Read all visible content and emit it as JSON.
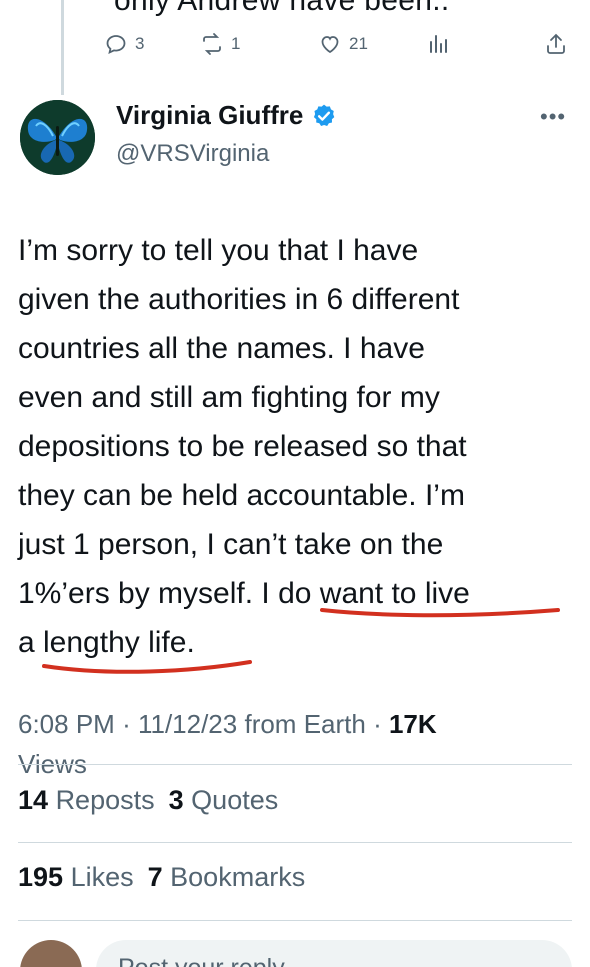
{
  "previous_tweet": {
    "text_fragment": "only Andrew have been..",
    "replies": "3",
    "reposts": "1",
    "likes": "21"
  },
  "tweet": {
    "display_name": "Virginia Giuffre",
    "handle": "@VRSVirginia",
    "text_lines": [
      "I’m sorry to tell you that I have",
      "given the authorities in 6 different",
      "countries all the names. I have",
      "even and still am fighting for my",
      "depositions to be released so that",
      "they can be held accountable. I’m",
      "just 1 person, I can’t take on the",
      "1%’ers by myself. I do want to live",
      "a lengthy life."
    ],
    "time": "6:08 PM",
    "date": "11/12/23",
    "source": "from Earth",
    "views_count": "17K",
    "views_label": "Views",
    "reposts_count": "14",
    "reposts_label": "Reposts",
    "quotes_count": "3",
    "quotes_label": "Quotes",
    "likes_count": "195",
    "likes_label": "Likes",
    "bookmarks_count": "7",
    "bookmarks_label": "Bookmarks"
  },
  "reply_box": {
    "placeholder": "Post your reply"
  },
  "icons": {
    "verified": "verified-badge-icon",
    "reply": "reply-icon",
    "repost": "repost-icon",
    "like": "heart-icon",
    "views": "analytics-icon",
    "share": "share-icon",
    "more": "more-icon"
  },
  "colors": {
    "verified_blue": "#1d9bf0",
    "annotation_red": "#d2301f",
    "secondary_text": "#536471"
  }
}
